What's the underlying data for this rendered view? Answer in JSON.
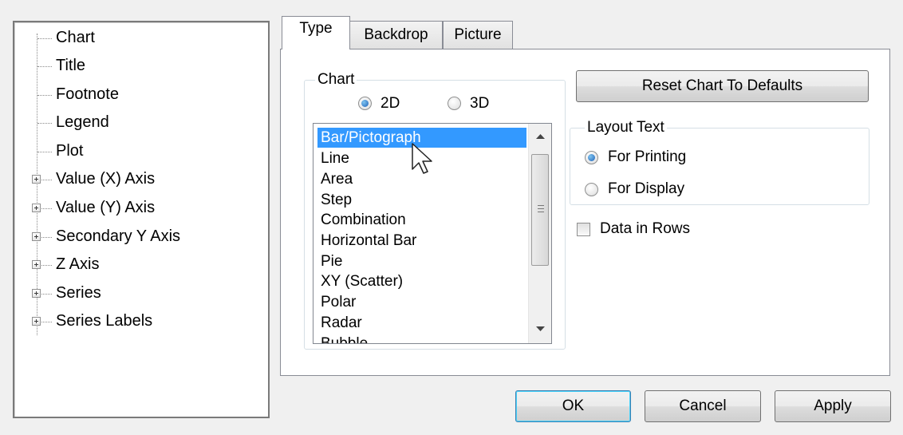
{
  "tree": {
    "items": [
      {
        "label": "Chart",
        "expandable": false
      },
      {
        "label": "Title",
        "expandable": false
      },
      {
        "label": "Footnote",
        "expandable": false
      },
      {
        "label": "Legend",
        "expandable": false
      },
      {
        "label": "Plot",
        "expandable": false
      },
      {
        "label": "Value (X) Axis",
        "expandable": true
      },
      {
        "label": "Value (Y) Axis",
        "expandable": true
      },
      {
        "label": "Secondary Y Axis",
        "expandable": true
      },
      {
        "label": "Z Axis",
        "expandable": true
      },
      {
        "label": "Series",
        "expandable": true
      },
      {
        "label": "Series Labels",
        "expandable": true
      }
    ],
    "selected": "Chart"
  },
  "tabs": [
    {
      "label": "Type",
      "active": true
    },
    {
      "label": "Backdrop",
      "active": false
    },
    {
      "label": "Picture",
      "active": false
    }
  ],
  "chart_group": {
    "legend": "Chart",
    "dimension_options": [
      {
        "label": "2D",
        "checked": true
      },
      {
        "label": "3D",
        "checked": false
      }
    ],
    "chart_types": [
      "Bar/Pictograph",
      "Line",
      "Area",
      "Step",
      "Combination",
      "Horizontal Bar",
      "Pie",
      "XY (Scatter)",
      "Polar",
      "Radar",
      "Bubble"
    ],
    "selected_type": "Bar/Pictograph"
  },
  "reset_button": "Reset Chart To Defaults",
  "layout_text": {
    "legend": "Layout Text",
    "options": [
      {
        "label": "For Printing",
        "checked": true
      },
      {
        "label": "For Display",
        "checked": false
      }
    ]
  },
  "data_in_rows": {
    "label": "Data in Rows",
    "checked": false
  },
  "dialog_buttons": {
    "ok": "OK",
    "cancel": "Cancel",
    "apply": "Apply"
  },
  "colors": {
    "selection": "#3399ff",
    "radio_dot": "#1f62b8",
    "default_button_border": "#3c7fb1"
  }
}
